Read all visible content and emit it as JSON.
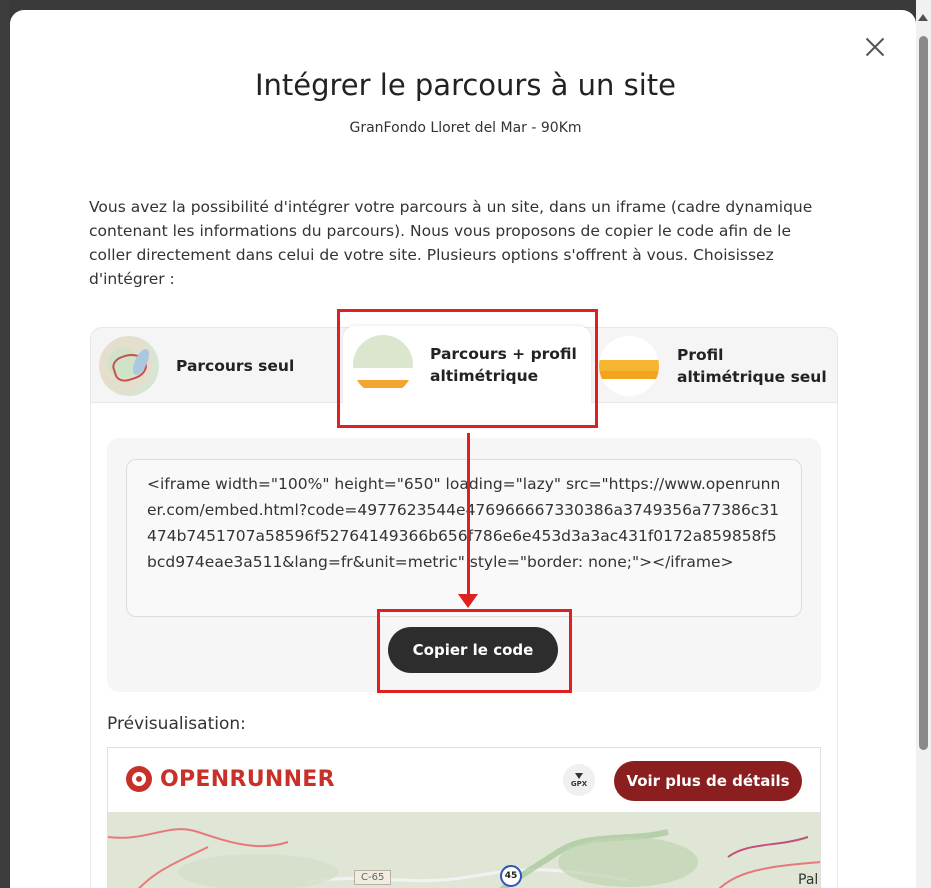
{
  "modal": {
    "title": "Intégrer le parcours à un site",
    "subtitle": "GranFondo Lloret del Mar - 90Km",
    "intro": "Vous avez la possibilité d'intégrer votre parcours à un site, dans un iframe (cadre dynamique contenant les informations du parcours). Nous vous proposons de copier le code afin de le coller directement dans celui de votre site. Plusieurs options s'offrent à vous. Choisissez d'intégrer :"
  },
  "tabs": [
    {
      "label": "Parcours seul",
      "icon": "map-thumbnail-icon",
      "selected": false
    },
    {
      "label": "Parcours + profil altimétrique",
      "icon": "map-profile-thumbnail-icon",
      "selected": true
    },
    {
      "label": "Profil altimétrique seul",
      "icon": "profile-thumbnail-icon",
      "selected": false
    }
  ],
  "embed": {
    "code": "<iframe width=\"100%\" height=\"650\" loading=\"lazy\" src=\"https://www.openrunner.com/embed.html?code=4977623544e476966667330386a3749356a77386c31474b7451707a58596f52764149366b656f786e6e453d3a3ac431f0172a859858f5bcd974eae3a511&lang=fr&unit=metric\" style=\"border: none;\"></iframe>",
    "copy_label": "Copier le code"
  },
  "preview": {
    "label": "Prévisualisation:",
    "brand": "OPENRUNNER",
    "gpx_label": "GPX",
    "details_label": "Voir plus de détails",
    "map": {
      "road_label": "C-65",
      "route_badge": "45",
      "city_label": "Pal"
    }
  },
  "colors": {
    "brand": "#c8312a",
    "details_button": "#8b1e1e",
    "copy_button": "#2d2d2d",
    "highlight": "#e02020"
  },
  "icons": {
    "close": "close-icon",
    "download": "download-gpx-icon",
    "logo": "openrunner-logo-icon"
  }
}
